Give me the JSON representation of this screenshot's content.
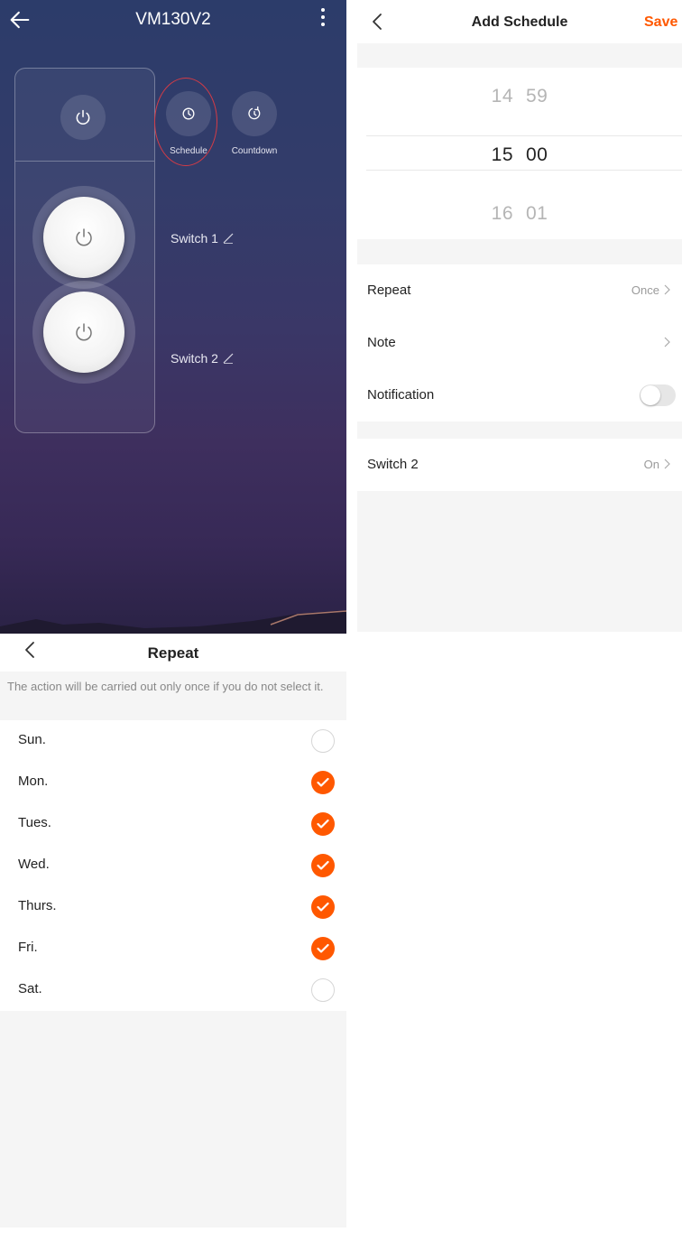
{
  "device_panel": {
    "title": "VM130V2",
    "actions": [
      {
        "label": "Schedule",
        "icon": "clock-icon"
      },
      {
        "label": "Countdown",
        "icon": "countdown-icon"
      }
    ],
    "switches": [
      {
        "label": "Switch 1",
        "state": "off"
      },
      {
        "label": "Switch 2",
        "state": "off"
      }
    ]
  },
  "schedule_panel": {
    "title": "Add Schedule",
    "save_label": "Save",
    "picker": {
      "rows": [
        {
          "hour": "14",
          "minute": "59"
        },
        {
          "hour": "15",
          "minute": "00"
        },
        {
          "hour": "16",
          "minute": "01"
        }
      ],
      "selected_index": 1
    },
    "rows": {
      "repeat": {
        "label": "Repeat",
        "value": "Once"
      },
      "note": {
        "label": "Note",
        "value": ""
      },
      "notification": {
        "label": "Notification",
        "enabled": false
      },
      "switch": {
        "label": "Switch 2",
        "value": "On"
      }
    }
  },
  "repeat_panel": {
    "title": "Repeat",
    "hint": "The action will be carried out only once if you do not select it.",
    "days": [
      {
        "label": "Sun.",
        "checked": false
      },
      {
        "label": "Mon.",
        "checked": true
      },
      {
        "label": "Tues.",
        "checked": true
      },
      {
        "label": "Wed.",
        "checked": true
      },
      {
        "label": "Thurs.",
        "checked": true
      },
      {
        "label": "Fri.",
        "checked": true
      },
      {
        "label": "Sat.",
        "checked": false
      }
    ]
  },
  "colors": {
    "accent": "#ff5800",
    "highlight_ring": "#d43b46"
  }
}
